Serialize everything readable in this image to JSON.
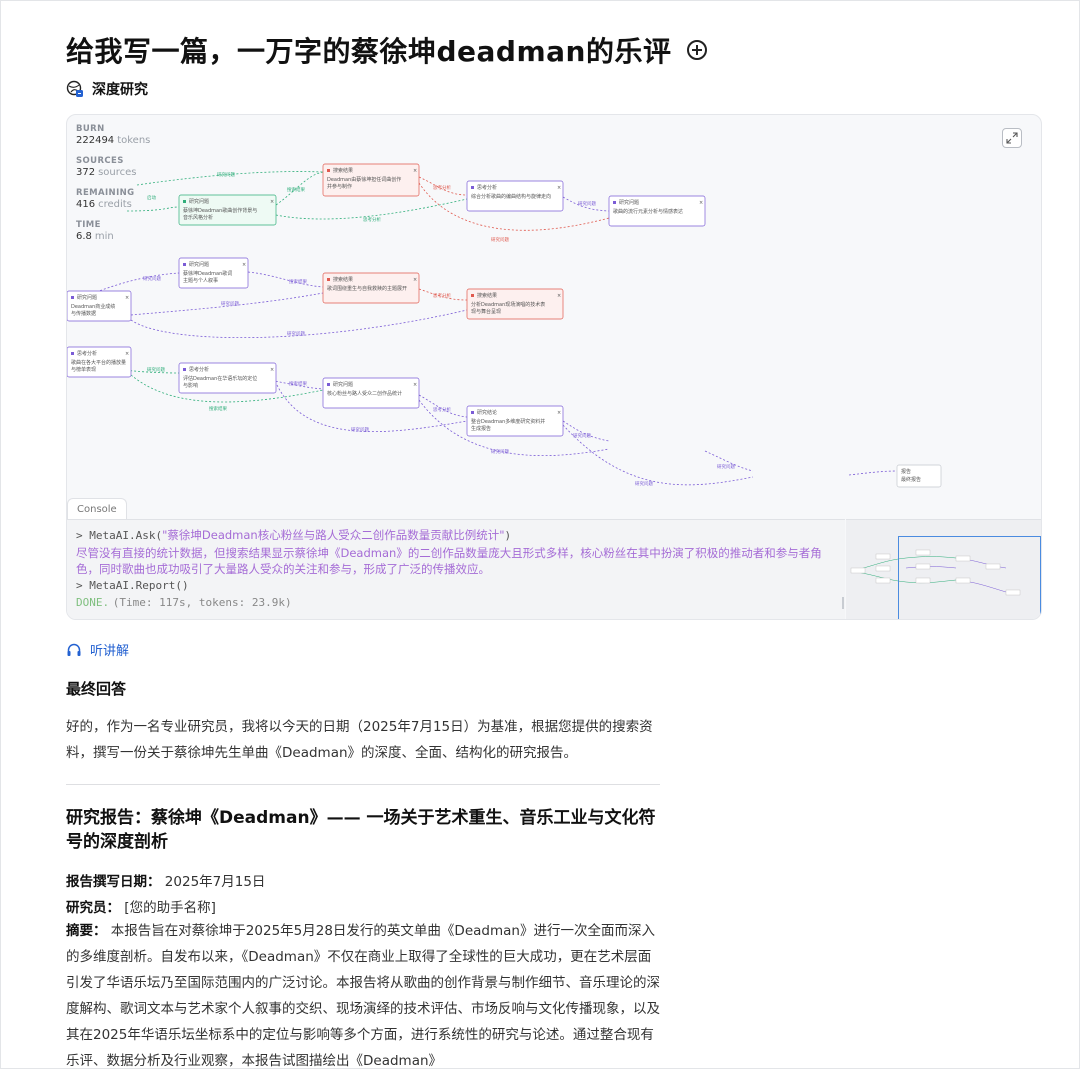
{
  "page": {
    "title": "给我写一篇，一万字的蔡徐坤deadman的乐评",
    "mode_label": "深度研究"
  },
  "stats": [
    {
      "label": "BURN",
      "value": "222494",
      "unit": "tokens"
    },
    {
      "label": "SOURCES",
      "value": "372",
      "unit": "sources"
    },
    {
      "label": "REMAINING",
      "value": "416",
      "unit": "credits"
    },
    {
      "label": "TIME",
      "value": "6.8",
      "unit": "min"
    }
  ],
  "console": {
    "tab_label": "Console",
    "ask_prefix": "> MetaAI.Ask(",
    "ask_query": "\"蔡徐坤Deadman核心粉丝与路人受众二创作品数量贡献比例统计\"",
    "ask_suffix": ")",
    "answer": "尽管没有直接的统计数据，但搜索结果显示蔡徐坤《Deadman》的二创作品数量庞大且形式多样，核心粉丝在其中扮演了积极的推动者和参与者角色，同时歌曲也成功吸引了大量路人受众的关注和参与，形成了广泛的传播效应。",
    "report_cmd": "> MetaAI.Report()",
    "done_label": "DONE.",
    "done_meta": "(Time: 117s, tokens: 23.9k)"
  },
  "listen_label": "听讲解",
  "answer_section": {
    "heading": "最终回答",
    "intro": "好的，作为一名专业研究员，我将以今天的日期（2025年7月15日）为基准，根据您提供的搜索资料，撰写一份关于蔡徐坤先生单曲《Deadman》的深度、全面、结构化的研究报告。"
  },
  "report": {
    "title": "研究报告：蔡徐坤《Deadman》—— 一场关于艺术重生、音乐工业与文化符号的深度剖析",
    "date_label": "报告撰写日期：",
    "date_value": "2025年7月15日",
    "author_label": "研究员：",
    "author_value": "[您的助手名称]",
    "abstract_label": "摘要：",
    "abstract_text": "本报告旨在对蔡徐坤于2025年5月28日发行的英文单曲《Deadman》进行一次全面而深入的多维度剖析。自发布以来，《Deadman》不仅在商业上取得了全球性的巨大成功，更在艺术层面引发了华语乐坛乃至国际范围内的广泛讨论。本报告将从歌曲的创作背景与制作细节、音乐理论的深度解构、歌词文本与艺术家个人叙事的交织、现场演绎的技术评估、市场反响与文化传播现象，以及其在2025年华语乐坛坐标系中的定位与影响等多个方面，进行系统性的研究与论述。通过整合现有乐评、数据分析及行业观察，本报告试图描绘出《Deadman》"
  },
  "graph_nodes": [
    {
      "title": "研究问题",
      "text": "蔡徐坤Deadman歌曲创作背景与音乐风格分析",
      "color": "#2fae7a"
    },
    {
      "title": "搜索结果",
      "text": "Deadman由蔡徐坤担任词曲创作并参与制作",
      "color": "#e05a4f"
    },
    {
      "title": "思考分析",
      "text": "综合分析歌曲的编曲结构与旋律走向",
      "color": "#7b5cd6"
    },
    {
      "title": "研究问题",
      "text": "歌曲的流行元素分析与情感表达",
      "color": "#7b5cd6"
    },
    {
      "title": "研究问题",
      "text": "蔡徐坤Deadman歌词主题与个人叙事",
      "color": "#7b5cd6"
    },
    {
      "title": "搜索结果",
      "text": "歌词围绕重生与自我救赎的主题展开",
      "color": "#e05a4f"
    },
    {
      "title": "搜索结果",
      "text": "分析Deadman现场演唱的技术表现与舞台呈现",
      "color": "#e05a4f"
    },
    {
      "title": "研究问题",
      "text": "Deadman商业成绩与传播数据",
      "color": "#7b5cd6"
    },
    {
      "title": "思考分析",
      "text": "歌曲在各大平台的播放量与榜单表现",
      "color": "#7b5cd6"
    },
    {
      "title": "思考分析",
      "text": "评估Deadman在华语乐坛的定位与影响",
      "color": "#7b5cd6"
    },
    {
      "title": "研究问题",
      "text": "核心粉丝与路人受众二创作品统计",
      "color": "#7b5cd6"
    },
    {
      "title": "研究结论",
      "text": "整合Deadman多维度研究资料并生成报告",
      "color": "#7b5cd6"
    }
  ],
  "graph_final": {
    "title": "报告",
    "text": "最终报告"
  }
}
